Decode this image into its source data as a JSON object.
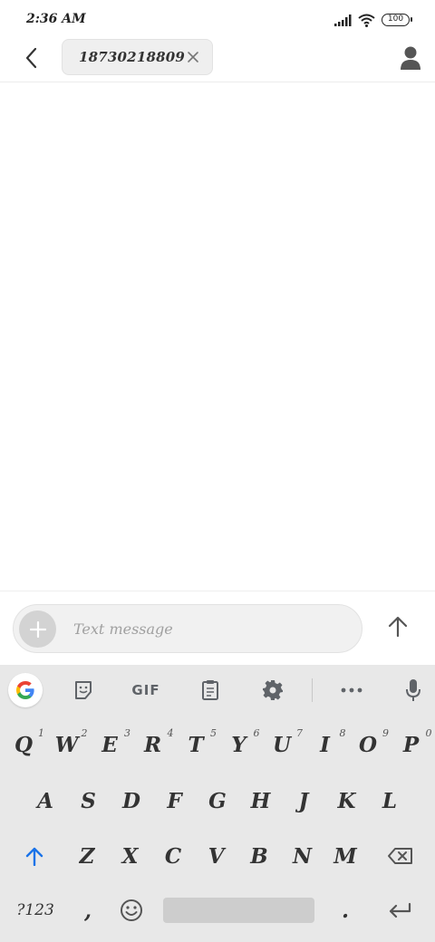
{
  "status_bar": {
    "time": "2:36 AM",
    "battery": "100",
    "icons": [
      "signal-icon",
      "wifi-icon",
      "battery-icon"
    ]
  },
  "header": {
    "recipient": "18730218809",
    "icons": [
      "back-arrow-icon",
      "close-icon",
      "contact-icon"
    ]
  },
  "composer": {
    "placeholder": "Text message",
    "value": "",
    "icons": [
      "add-icon",
      "send-arrow-icon"
    ]
  },
  "keyboard": {
    "toolbar": {
      "gif_label": "GIF",
      "icons": [
        "google-icon",
        "sticker-icon",
        "gif-icon",
        "clipboard-icon",
        "settings-icon",
        "more-icon",
        "microphone-icon"
      ]
    },
    "row1": [
      {
        "label": "Q",
        "hint": "1"
      },
      {
        "label": "W",
        "hint": "2"
      },
      {
        "label": "E",
        "hint": "3"
      },
      {
        "label": "R",
        "hint": "4"
      },
      {
        "label": "T",
        "hint": "5"
      },
      {
        "label": "Y",
        "hint": "6"
      },
      {
        "label": "U",
        "hint": "7"
      },
      {
        "label": "I",
        "hint": "8"
      },
      {
        "label": "O",
        "hint": "9"
      },
      {
        "label": "P",
        "hint": "0"
      }
    ],
    "row2": [
      "A",
      "S",
      "D",
      "F",
      "G",
      "H",
      "J",
      "K",
      "L"
    ],
    "row3": [
      "Z",
      "X",
      "C",
      "V",
      "B",
      "N",
      "M"
    ],
    "row4": {
      "symbols_label": "?123",
      "comma_label": ",",
      "period_label": "."
    },
    "accent_color": "#1a73e8"
  }
}
